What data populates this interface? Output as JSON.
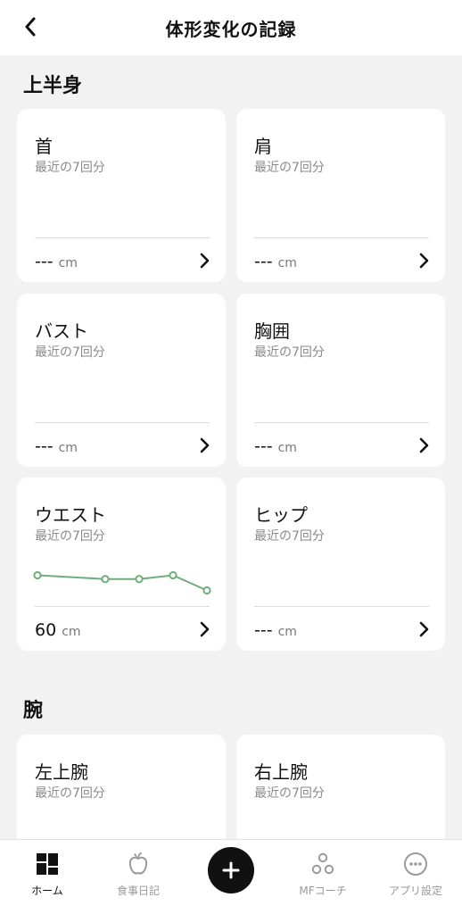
{
  "header": {
    "title": "体形変化の記録"
  },
  "sections": [
    {
      "title": "上半身",
      "cards": [
        {
          "title": "首",
          "subtitle": "最近の7回分",
          "value": "---",
          "unit": "cm"
        },
        {
          "title": "肩",
          "subtitle": "最近の7回分",
          "value": "---",
          "unit": "cm"
        },
        {
          "title": "バスト",
          "subtitle": "最近の7回分",
          "value": "---",
          "unit": "cm"
        },
        {
          "title": "胸囲",
          "subtitle": "最近の7回分",
          "value": "---",
          "unit": "cm"
        },
        {
          "title": "ウエスト",
          "subtitle": "最近の7回分",
          "value": "60",
          "unit": "cm"
        },
        {
          "title": "ヒップ",
          "subtitle": "最近の7回分",
          "value": "---",
          "unit": "cm"
        }
      ]
    },
    {
      "title": "腕",
      "cards": [
        {
          "title": "左上腕",
          "subtitle": "最近の7回分"
        },
        {
          "title": "右上腕",
          "subtitle": "最近の7回分"
        }
      ]
    }
  ],
  "chart_data": {
    "type": "line",
    "x": [
      1,
      3,
      4,
      5,
      6
    ],
    "values": [
      62,
      61.5,
      61.5,
      62,
      60
    ],
    "ylim": [
      59,
      63
    ],
    "xlim": [
      1,
      6
    ],
    "color": "#6fae7a"
  },
  "tabbar": {
    "items": [
      {
        "label": "ホーム",
        "icon": "home-grid-icon",
        "active": true
      },
      {
        "label": "食事日記",
        "icon": "apple-icon",
        "active": false
      },
      {
        "label": "",
        "icon": "plus-icon",
        "active": false
      },
      {
        "label": "MFコーチ",
        "icon": "coach-circles-icon",
        "active": false
      },
      {
        "label": "アプリ設定",
        "icon": "more-dots-icon",
        "active": false
      }
    ]
  }
}
